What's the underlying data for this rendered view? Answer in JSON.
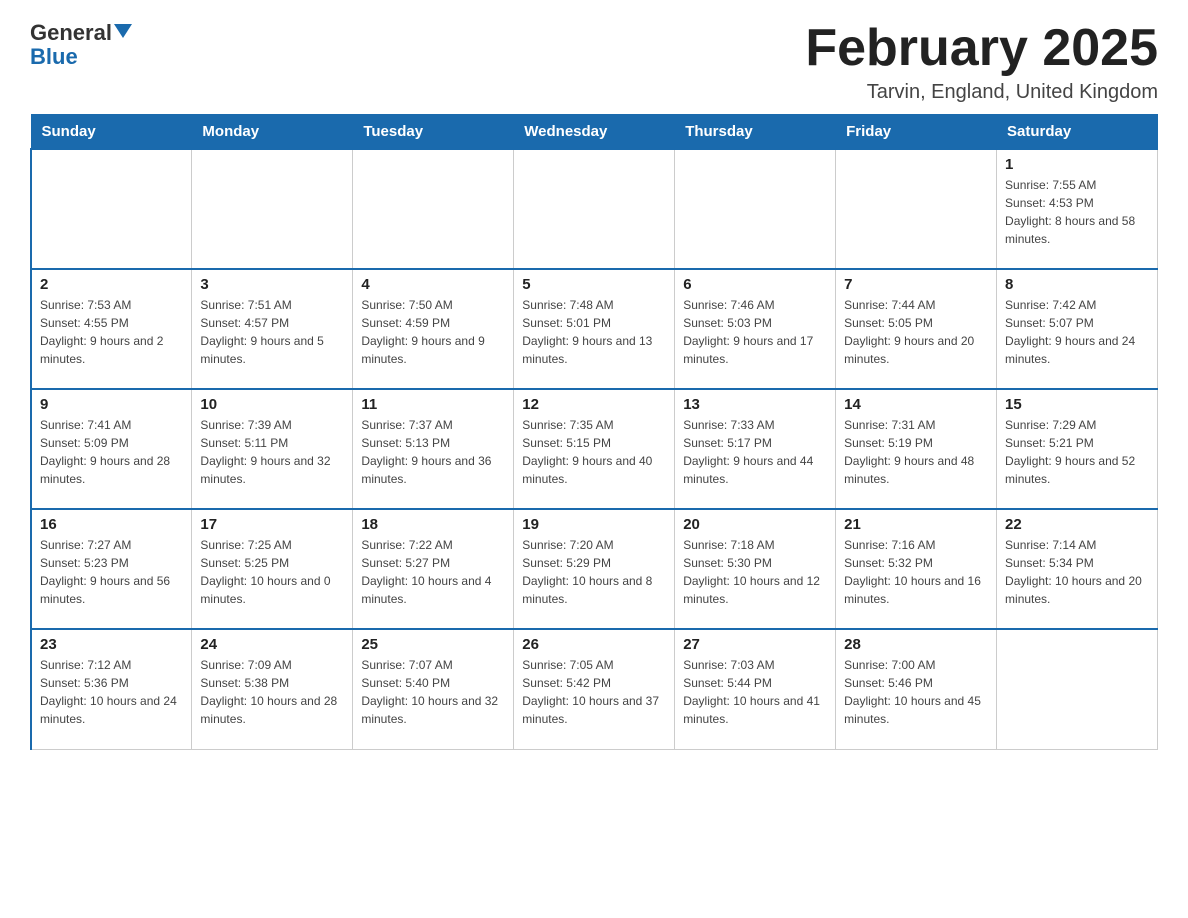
{
  "logo": {
    "text_general": "General",
    "text_blue": "Blue"
  },
  "header": {
    "month_title": "February 2025",
    "location": "Tarvin, England, United Kingdom"
  },
  "days_of_week": [
    "Sunday",
    "Monday",
    "Tuesday",
    "Wednesday",
    "Thursday",
    "Friday",
    "Saturday"
  ],
  "weeks": [
    [
      {
        "day": "",
        "info": ""
      },
      {
        "day": "",
        "info": ""
      },
      {
        "day": "",
        "info": ""
      },
      {
        "day": "",
        "info": ""
      },
      {
        "day": "",
        "info": ""
      },
      {
        "day": "",
        "info": ""
      },
      {
        "day": "1",
        "info": "Sunrise: 7:55 AM\nSunset: 4:53 PM\nDaylight: 8 hours and 58 minutes."
      }
    ],
    [
      {
        "day": "2",
        "info": "Sunrise: 7:53 AM\nSunset: 4:55 PM\nDaylight: 9 hours and 2 minutes."
      },
      {
        "day": "3",
        "info": "Sunrise: 7:51 AM\nSunset: 4:57 PM\nDaylight: 9 hours and 5 minutes."
      },
      {
        "day": "4",
        "info": "Sunrise: 7:50 AM\nSunset: 4:59 PM\nDaylight: 9 hours and 9 minutes."
      },
      {
        "day": "5",
        "info": "Sunrise: 7:48 AM\nSunset: 5:01 PM\nDaylight: 9 hours and 13 minutes."
      },
      {
        "day": "6",
        "info": "Sunrise: 7:46 AM\nSunset: 5:03 PM\nDaylight: 9 hours and 17 minutes."
      },
      {
        "day": "7",
        "info": "Sunrise: 7:44 AM\nSunset: 5:05 PM\nDaylight: 9 hours and 20 minutes."
      },
      {
        "day": "8",
        "info": "Sunrise: 7:42 AM\nSunset: 5:07 PM\nDaylight: 9 hours and 24 minutes."
      }
    ],
    [
      {
        "day": "9",
        "info": "Sunrise: 7:41 AM\nSunset: 5:09 PM\nDaylight: 9 hours and 28 minutes."
      },
      {
        "day": "10",
        "info": "Sunrise: 7:39 AM\nSunset: 5:11 PM\nDaylight: 9 hours and 32 minutes."
      },
      {
        "day": "11",
        "info": "Sunrise: 7:37 AM\nSunset: 5:13 PM\nDaylight: 9 hours and 36 minutes."
      },
      {
        "day": "12",
        "info": "Sunrise: 7:35 AM\nSunset: 5:15 PM\nDaylight: 9 hours and 40 minutes."
      },
      {
        "day": "13",
        "info": "Sunrise: 7:33 AM\nSunset: 5:17 PM\nDaylight: 9 hours and 44 minutes."
      },
      {
        "day": "14",
        "info": "Sunrise: 7:31 AM\nSunset: 5:19 PM\nDaylight: 9 hours and 48 minutes."
      },
      {
        "day": "15",
        "info": "Sunrise: 7:29 AM\nSunset: 5:21 PM\nDaylight: 9 hours and 52 minutes."
      }
    ],
    [
      {
        "day": "16",
        "info": "Sunrise: 7:27 AM\nSunset: 5:23 PM\nDaylight: 9 hours and 56 minutes."
      },
      {
        "day": "17",
        "info": "Sunrise: 7:25 AM\nSunset: 5:25 PM\nDaylight: 10 hours and 0 minutes."
      },
      {
        "day": "18",
        "info": "Sunrise: 7:22 AM\nSunset: 5:27 PM\nDaylight: 10 hours and 4 minutes."
      },
      {
        "day": "19",
        "info": "Sunrise: 7:20 AM\nSunset: 5:29 PM\nDaylight: 10 hours and 8 minutes."
      },
      {
        "day": "20",
        "info": "Sunrise: 7:18 AM\nSunset: 5:30 PM\nDaylight: 10 hours and 12 minutes."
      },
      {
        "day": "21",
        "info": "Sunrise: 7:16 AM\nSunset: 5:32 PM\nDaylight: 10 hours and 16 minutes."
      },
      {
        "day": "22",
        "info": "Sunrise: 7:14 AM\nSunset: 5:34 PM\nDaylight: 10 hours and 20 minutes."
      }
    ],
    [
      {
        "day": "23",
        "info": "Sunrise: 7:12 AM\nSunset: 5:36 PM\nDaylight: 10 hours and 24 minutes."
      },
      {
        "day": "24",
        "info": "Sunrise: 7:09 AM\nSunset: 5:38 PM\nDaylight: 10 hours and 28 minutes."
      },
      {
        "day": "25",
        "info": "Sunrise: 7:07 AM\nSunset: 5:40 PM\nDaylight: 10 hours and 32 minutes."
      },
      {
        "day": "26",
        "info": "Sunrise: 7:05 AM\nSunset: 5:42 PM\nDaylight: 10 hours and 37 minutes."
      },
      {
        "day": "27",
        "info": "Sunrise: 7:03 AM\nSunset: 5:44 PM\nDaylight: 10 hours and 41 minutes."
      },
      {
        "day": "28",
        "info": "Sunrise: 7:00 AM\nSunset: 5:46 PM\nDaylight: 10 hours and 45 minutes."
      },
      {
        "day": "",
        "info": ""
      }
    ]
  ]
}
